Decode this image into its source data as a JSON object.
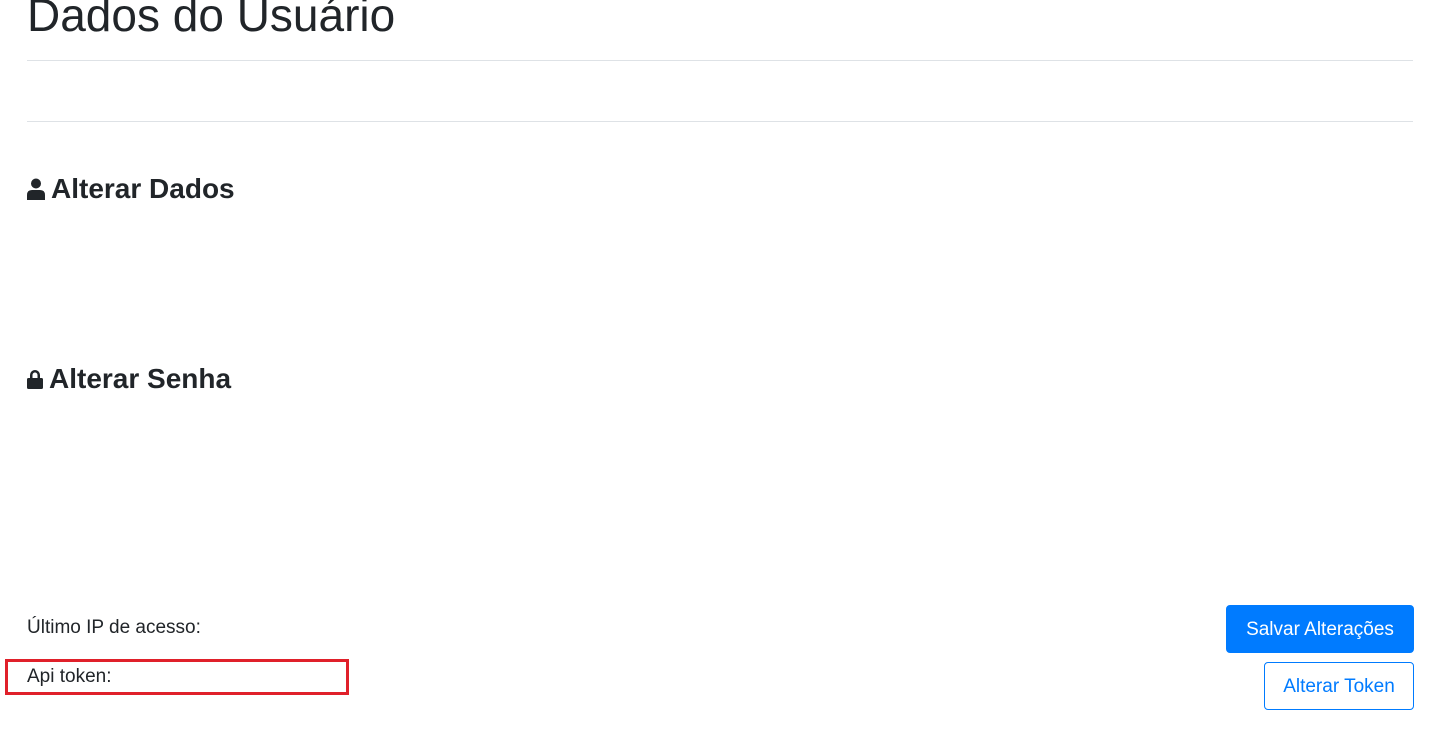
{
  "page": {
    "title": "Dados do Usuário"
  },
  "sections": {
    "dados": {
      "heading": "Alterar Dados",
      "icon": "user-icon"
    },
    "senha": {
      "heading": "Alterar Senha",
      "icon": "lock-icon"
    }
  },
  "info": {
    "last_ip_label": "Último IP de acesso:",
    "api_token_label": "Api token:"
  },
  "actions": {
    "save_label": "Salvar Alterações",
    "change_token_label": "Alterar Token"
  },
  "colors": {
    "primary": "#007bff",
    "highlight": "#e0202a",
    "text": "#212529",
    "divider": "#dee2e6"
  }
}
